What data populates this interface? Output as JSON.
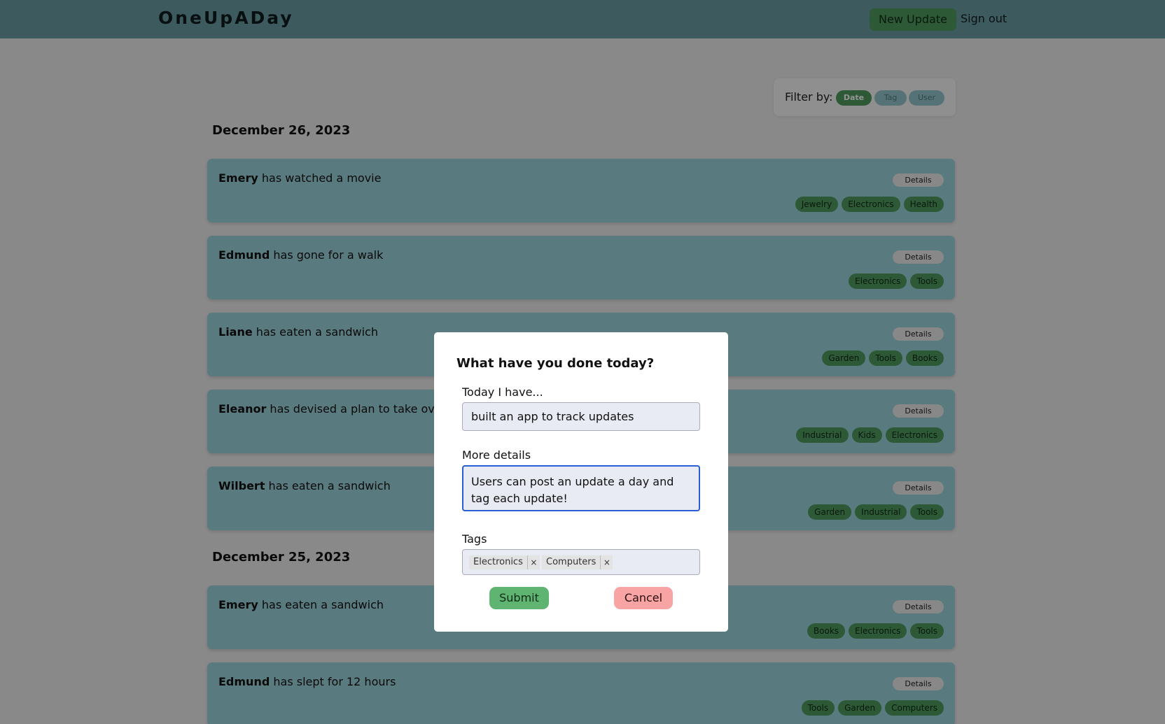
{
  "header": {
    "logo": "OneUpADay",
    "new_update_label": "New Update",
    "sign_out_label": "Sign out"
  },
  "filter": {
    "label": "Filter by:",
    "options": [
      "Date",
      "Tag",
      "User"
    ],
    "selected": "Date"
  },
  "groups": [
    {
      "date": "December 26, 2023",
      "updates": [
        {
          "user": "Emery",
          "text": " has watched a movie",
          "details_label": "Details",
          "tags": [
            "Jewelry",
            "Electronics",
            "Health"
          ]
        },
        {
          "user": "Edmund",
          "text": " has gone for a walk",
          "details_label": "Details",
          "tags": [
            "Electronics",
            "Tools"
          ]
        },
        {
          "user": "Liane",
          "text": " has eaten a sandwich",
          "details_label": "Details",
          "tags": [
            "Garden",
            "Tools",
            "Books"
          ]
        },
        {
          "user": "Eleanor",
          "text": " has devised a plan to take over t",
          "details_label": "Details",
          "tags": [
            "Industrial",
            "Kids",
            "Electronics"
          ]
        },
        {
          "user": "Wilbert",
          "text": " has eaten a sandwich",
          "details_label": "Details",
          "tags": [
            "Garden",
            "Industrial",
            "Tools"
          ]
        }
      ]
    },
    {
      "date": "December 25, 2023",
      "updates": [
        {
          "user": "Emery",
          "text": " has eaten a sandwich",
          "details_label": "Details",
          "tags": [
            "Books",
            "Electronics",
            "Tools"
          ]
        },
        {
          "user": "Edmund",
          "text": " has slept for 12 hours",
          "details_label": "Details",
          "tags": [
            "Tools",
            "Garden",
            "Computers"
          ]
        }
      ]
    }
  ],
  "modal": {
    "title": "What have you done today?",
    "today_label": "Today I have...",
    "today_value": "built an app to track updates",
    "details_label": "More details",
    "details_value": "Users can post an update a day and tag each update!",
    "tags_label": "Tags",
    "tags": [
      "Electronics",
      "Computers"
    ],
    "remove_symbol": "×",
    "submit_label": "Submit",
    "cancel_label": "Cancel"
  },
  "colors": {
    "header": "#6a9da3",
    "card": "#9ad3da",
    "tag": "#4e9a5f",
    "submit": "#5fb472",
    "cancel": "#f8a4a4",
    "focus": "#2a5fd1"
  }
}
